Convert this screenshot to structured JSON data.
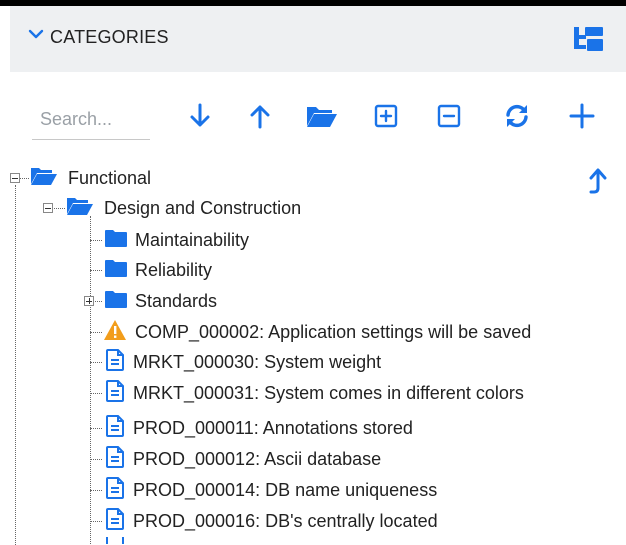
{
  "header": {
    "title": "CATEGORIES"
  },
  "toolbar": {
    "search_placeholder": "Search...",
    "accent_color": "#1a73e8",
    "buttons": [
      {
        "icon": "arrow-down-icon",
        "action": "move-down"
      },
      {
        "icon": "arrow-up-icon",
        "action": "move-up"
      },
      {
        "icon": "folder-open-icon",
        "action": "open-folder"
      },
      {
        "icon": "expand-all-icon",
        "action": "expand-all"
      },
      {
        "icon": "collapse-all-icon",
        "action": "collapse-all"
      },
      {
        "icon": "refresh-icon",
        "action": "refresh"
      },
      {
        "icon": "plus-icon",
        "action": "add"
      }
    ]
  },
  "tree": {
    "root": {
      "label": "Functional",
      "icon": "folder-open-icon",
      "expanded": true
    },
    "design": {
      "label": "Design and Construction",
      "icon": "folder-open-icon",
      "expanded": true
    },
    "children": [
      {
        "label": "Maintainability",
        "icon": "folder-icon"
      },
      {
        "label": "Reliability",
        "icon": "folder-icon"
      },
      {
        "label": "Standards",
        "icon": "folder-icon",
        "collapsed": true
      },
      {
        "label": "COMP_000002: Application settings will be saved",
        "icon": "warning-icon"
      },
      {
        "label": "MRKT_000030: System weight",
        "icon": "document-icon"
      },
      {
        "label": "MRKT_000031: System comes in different colors",
        "icon": "document-icon"
      },
      {
        "label": "PROD_000011: Annotations stored",
        "icon": "document-icon"
      },
      {
        "label": "PROD_000012: Ascii database",
        "icon": "document-icon"
      },
      {
        "label": "PROD_000014: DB name uniqueness",
        "icon": "document-icon"
      },
      {
        "label": "PROD_000016: DB's centrally located",
        "icon": "document-icon"
      }
    ]
  }
}
